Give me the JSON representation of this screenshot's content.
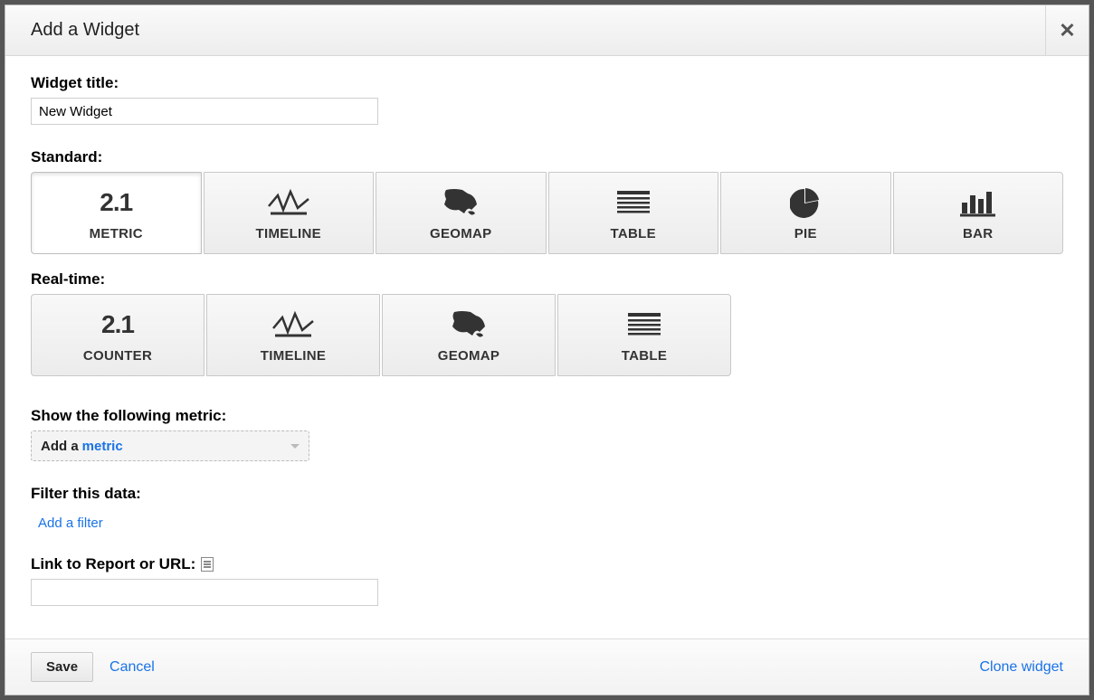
{
  "dialog": {
    "title": "Add a Widget"
  },
  "fields": {
    "widget_title_label": "Widget title:",
    "widget_title_value": "New Widget",
    "standard_label": "Standard:",
    "realtime_label": "Real-time:",
    "show_metric_label": "Show the following metric:",
    "add_metric_prefix": "Add a",
    "add_metric_link": "metric",
    "filter_label": "Filter this data:",
    "add_filter_link": "Add a filter",
    "link_report_label": "Link to Report or URL:",
    "link_report_value": ""
  },
  "types": {
    "standard": [
      {
        "id": "metric",
        "label": "METRIC"
      },
      {
        "id": "timeline",
        "label": "TIMELINE"
      },
      {
        "id": "geomap",
        "label": "GEOMAP"
      },
      {
        "id": "table",
        "label": "TABLE"
      },
      {
        "id": "pie",
        "label": "PIE"
      },
      {
        "id": "bar",
        "label": "BAR"
      }
    ],
    "realtime": [
      {
        "id": "counter",
        "label": "COUNTER"
      },
      {
        "id": "timeline",
        "label": "TIMELINE"
      },
      {
        "id": "geomap",
        "label": "GEOMAP"
      },
      {
        "id": "table",
        "label": "TABLE"
      }
    ],
    "selected": "metric"
  },
  "footer": {
    "save": "Save",
    "cancel": "Cancel",
    "clone": "Clone widget"
  }
}
